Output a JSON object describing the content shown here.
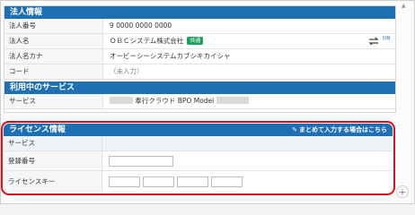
{
  "corp": {
    "title": "法人情報",
    "rows": [
      {
        "label": "法人番号",
        "value": "9 0000  0000 0000"
      },
      {
        "label": "法人名",
        "value": "ＯＢＣシステム株式会社",
        "badge": "共通"
      },
      {
        "label": "法人名カナ",
        "value": "オービーシーシステムカブシキカイシャ"
      },
      {
        "label": "コード",
        "value": "（未入力）"
      }
    ],
    "switch_icon_text": "切替"
  },
  "services": {
    "title": "利用中のサービス",
    "label": "サービス",
    "value": "奉行クラウド BPO Model"
  },
  "license": {
    "title": "ライセンス情報",
    "bulk_link": "まとめて入力する場合はこちら",
    "service_label": "サービス",
    "reg_label": "登録番号",
    "key_label": "ライセンスキー"
  },
  "colors": {
    "header": "#1f6fb5",
    "highlight": "#d8121b",
    "badge": "#1aa05a"
  }
}
